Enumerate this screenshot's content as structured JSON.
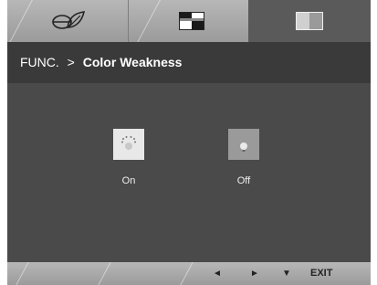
{
  "tabs": [
    {
      "icon": "eco-leaf-icon"
    },
    {
      "icon": "picture-mode-icon"
    },
    {
      "icon": "function-icon"
    }
  ],
  "title": {
    "prefix": "FUNC.",
    "separator": ">",
    "name": "Color Weakness"
  },
  "options": [
    {
      "label": "On",
      "icon": "bulb-rays-icon",
      "selected": true
    },
    {
      "label": "Off",
      "icon": "bulb-off-icon",
      "selected": false
    }
  ],
  "navigation": {
    "left": "◄",
    "right": "►",
    "down": "▼",
    "exit": "EXIT"
  }
}
